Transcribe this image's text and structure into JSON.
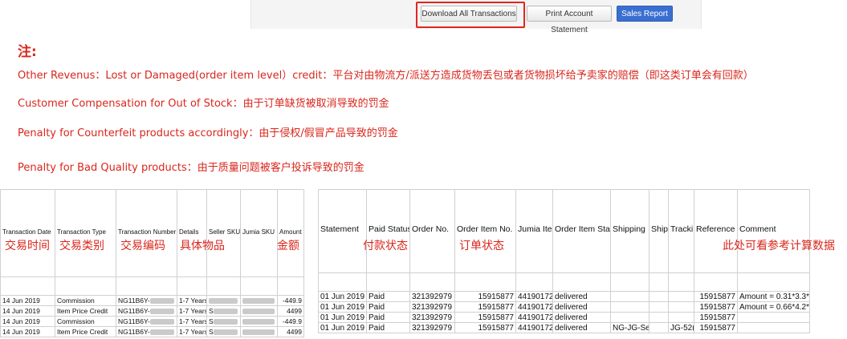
{
  "toolbar": {
    "download_label": "Download All Transactions",
    "print_label": "Print Account Statement",
    "sales_label": "Sales Report",
    "highlight_color": "#e0261f",
    "sales_color": "#3a6fd1"
  },
  "notes": {
    "title": "注:",
    "lines": [
      "Other Revenus：Lost or  Damaged(order item level）credit：平台对由物流方/派送方造成货物丢包或者货物损坏给予卖家的赔偿（即这类订单会有回款）",
      "Customer Compensation for  Out of Stock：由于订单缺货被取消导致的罚金",
      "Penalty for Counterfeit products  accordingly：由于侵权/假冒产品导致的罚金",
      "Penalty for Bad Quality  products：由于质量问题被客户投诉导致的罚金"
    ],
    "color": "#d9261c"
  },
  "left_table": {
    "headers": [
      "Transaction Date",
      "Transaction Type",
      "Transaction Number",
      "Details",
      "Seller SKU",
      "Jumia SKU",
      "Amount"
    ],
    "cn_labels": {
      "date": "交易时间",
      "type": "交易类别",
      "number": "交易编码",
      "details": "具体物品",
      "amount": "金额"
    },
    "rows": [
      [
        "14 Jun 2019",
        "Commission",
        "NG11B6Y-",
        "1-7 Years",
        "",
        "",
        "-449.9"
      ],
      [
        "14 Jun 2019",
        "Item Price Credit",
        "NG11B6Y-",
        "1-7 Years",
        "S",
        "",
        "4499"
      ],
      [
        "14 Jun 2019",
        "Commission",
        "NG11B6Y-",
        "1-7 Years",
        "S",
        "",
        "-449.9"
      ],
      [
        "14 Jun 2019",
        "Item Price Credit",
        "NG11B6Y-",
        "1-7 Years",
        "S",
        "",
        "4499"
      ]
    ]
  },
  "right_table": {
    "headers": [
      "Statement",
      "Paid Status",
      "Order No.",
      "Order Item No.",
      "Jumia Iter",
      "Order Item Stat",
      "Shipping",
      "Shipp",
      "Tracki",
      "Reference",
      "Comment"
    ],
    "cn_labels": {
      "paid": "付款状态",
      "status": "订单状态",
      "reference": "此处可看参考计算数据"
    },
    "rows": [
      [
        "01 Jun 2019 -",
        "Paid",
        "321392979",
        "15915877",
        "44190172",
        "delivered",
        "",
        "",
        "",
        "15915877",
        "Amount = 0.31*3.3*"
      ],
      [
        "01 Jun 2019 -",
        "Paid",
        "321392979",
        "15915877",
        "44190172",
        "delivered",
        "",
        "",
        "",
        "15915877",
        "Amount = 0.66*4.2*"
      ],
      [
        "01 Jun 2019 -",
        "Paid",
        "321392979",
        "15915877",
        "44190172",
        "delivered",
        "",
        "",
        "",
        "15915877",
        ""
      ],
      [
        "01 Jun 2019 -",
        "Paid",
        "321392979",
        "15915877",
        "44190172",
        "delivered",
        "NG-JG-Se",
        "",
        "JG-52(",
        "15915877",
        ""
      ]
    ]
  }
}
